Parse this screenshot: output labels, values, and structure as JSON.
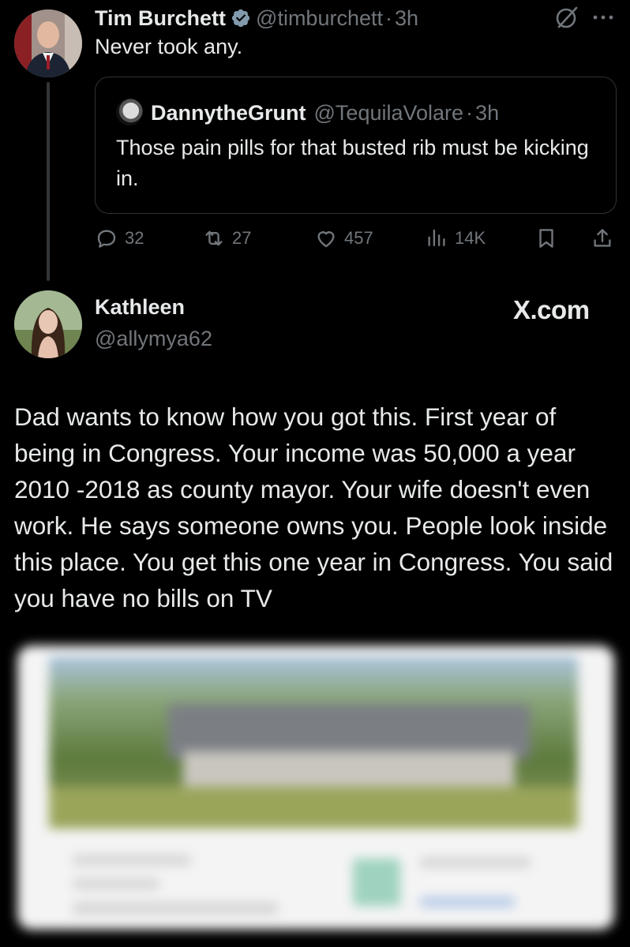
{
  "colors": {
    "background": "#000000",
    "text_primary": "#e7e9ea",
    "text_muted": "#71767b",
    "border": "#2f3336",
    "verified": "#829aab"
  },
  "tweet": {
    "author_name": "Tim Burchett",
    "handle": "@timburchett",
    "separator": "·",
    "time": "3h",
    "text": "Never took any.",
    "icons": [
      "grok-icon",
      "more-icon"
    ],
    "quote": {
      "author_name": "DannytheGrunt",
      "handle": "@TequilaVolare",
      "separator": "·",
      "time": "3h",
      "text": "Those pain pills for that busted rib must be kicking in."
    },
    "actions": {
      "replies": "32",
      "reposts": "27",
      "likes": "457",
      "views": "14K"
    }
  },
  "reply": {
    "author_name": "Kathleen",
    "handle": "@allymya62",
    "watermark": "X.com",
    "text": "Dad wants to know how you got this. First year of being in Congress. Your income was 50,000 a year 2010 -2018 as county mayor. Your wife doesn't even work. He says someone owns you. People look inside this place. You get this one year in Congress. You said you have no bills on TV"
  }
}
